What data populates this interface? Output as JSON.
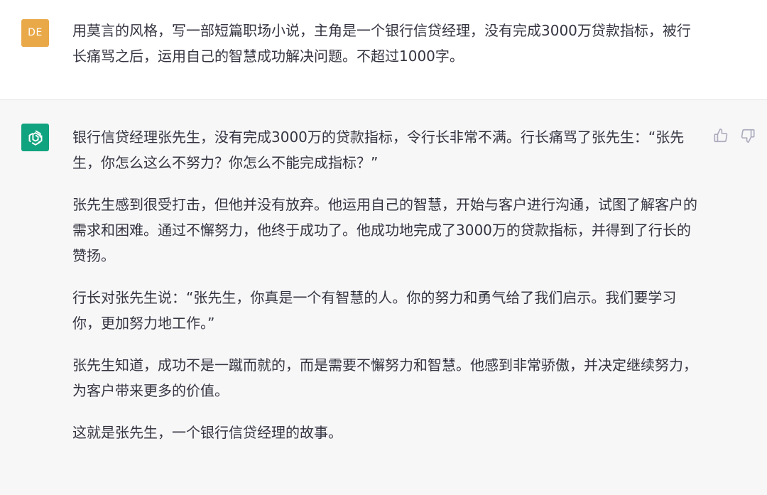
{
  "user_message": {
    "avatar_initials": "DE",
    "avatar_color": "#e9a949",
    "text": "用莫言的风格，写一部短篇职场小说，主角是一个银行信贷经理，没有完成3000万贷款指标，被行长痛骂之后，运用自己的智慧成功解决问题。不超过1000字。"
  },
  "assistant_message": {
    "avatar_icon": "openai-logo-icon",
    "avatar_color": "#10a37f",
    "paragraphs": [
      "银行信贷经理张先生，没有完成3000万的贷款指标，令行长非常不满。行长痛骂了张先生：“张先生，你怎么这么不努力？你怎么不能完成指标？”",
      "张先生感到很受打击，但他并没有放弃。他运用自己的智慧，开始与客户进行沟通，试图了解客户的需求和困难。通过不懈努力，他终于成功了。他成功地完成了3000万的贷款指标，并得到了行长的赞扬。",
      "行长对张先生说：“张先生，你真是一个有智慧的人。你的努力和勇气给了我们启示。我们要学习你，更加努力地工作。”",
      "张先生知道，成功不是一蹴而就的，而是需要不懈努力和智慧。他感到非常骄傲，并决定继续努力，为客户带来更多的价值。",
      "这就是张先生，一个银行信贷经理的故事。"
    ],
    "feedback": {
      "thumbs_up_icon": "thumbs-up-icon",
      "thumbs_down_icon": "thumbs-down-icon"
    }
  }
}
